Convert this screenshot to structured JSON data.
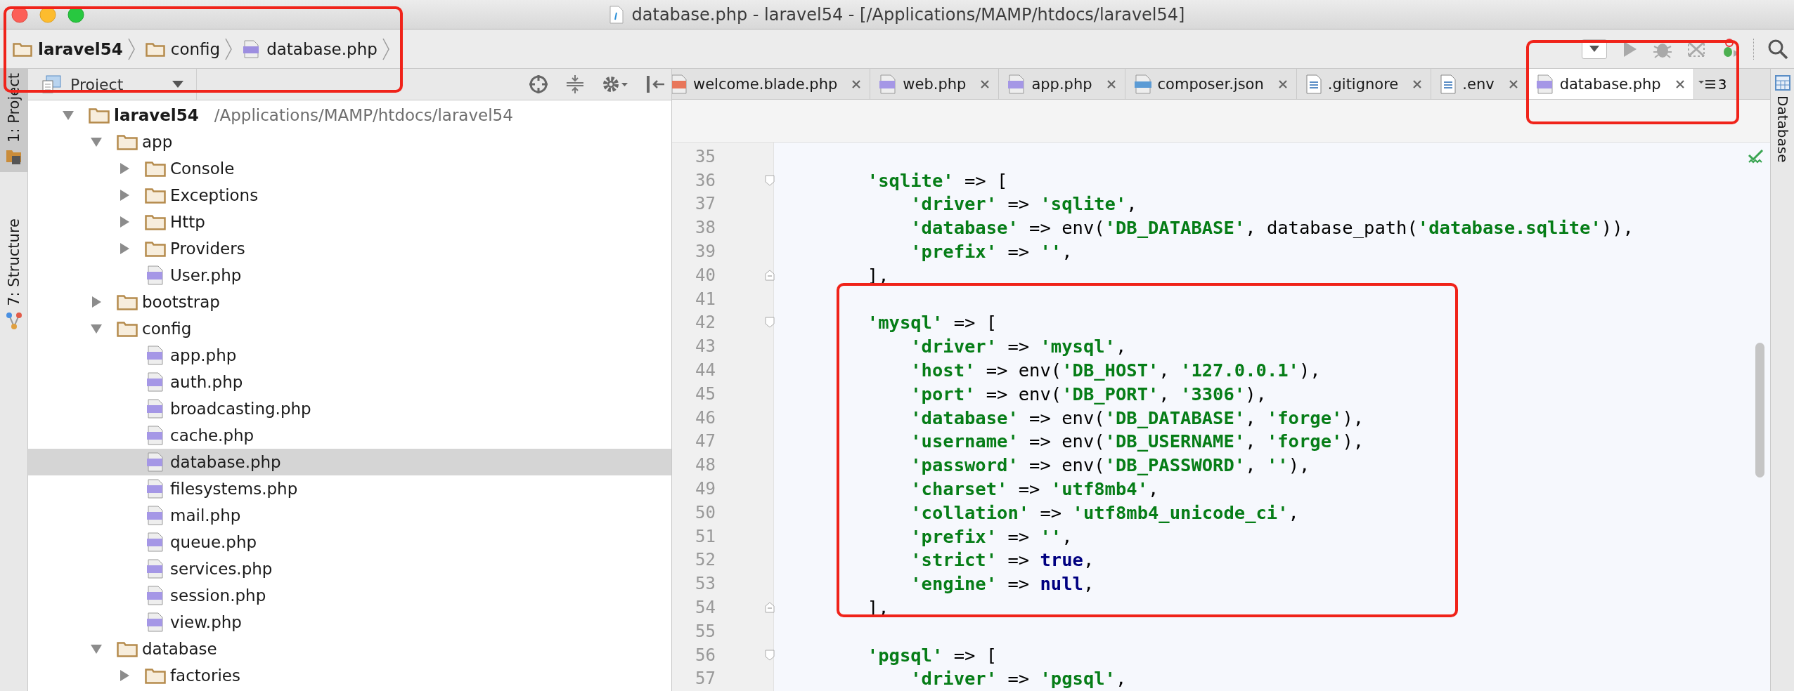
{
  "window": {
    "title": "database.php - laravel54 - [/Applications/MAMP/htdocs/laravel54]"
  },
  "breadcrumbs": [
    {
      "label": "laravel54",
      "kind": "project"
    },
    {
      "label": "config",
      "kind": "folder"
    },
    {
      "label": "database.php",
      "kind": "php"
    }
  ],
  "left_tool_tabs": [
    {
      "label": "1: Project",
      "selected": true
    },
    {
      "label": "7: Structure",
      "selected": false
    }
  ],
  "project_panel": {
    "title": "Project",
    "tree": [
      {
        "label": "laravel54",
        "path": "/Applications/MAMP/htdocs/laravel54",
        "kind": "project",
        "expanded": true,
        "selected": false,
        "children": [
          {
            "label": "app",
            "kind": "folder",
            "expanded": true,
            "selected": false,
            "children": [
              {
                "label": "Console",
                "kind": "folder",
                "expanded": false,
                "selected": false
              },
              {
                "label": "Exceptions",
                "kind": "folder",
                "expanded": false,
                "selected": false
              },
              {
                "label": "Http",
                "kind": "folder",
                "expanded": false,
                "selected": false
              },
              {
                "label": "Providers",
                "kind": "folder",
                "expanded": false,
                "selected": false
              },
              {
                "label": "User.php",
                "kind": "php",
                "selected": false
              }
            ]
          },
          {
            "label": "bootstrap",
            "kind": "folder",
            "expanded": false,
            "selected": false
          },
          {
            "label": "config",
            "kind": "folder",
            "expanded": true,
            "selected": false,
            "children": [
              {
                "label": "app.php",
                "kind": "php",
                "selected": false
              },
              {
                "label": "auth.php",
                "kind": "php",
                "selected": false
              },
              {
                "label": "broadcasting.php",
                "kind": "php",
                "selected": false
              },
              {
                "label": "cache.php",
                "kind": "php",
                "selected": false
              },
              {
                "label": "database.php",
                "kind": "php",
                "selected": true
              },
              {
                "label": "filesystems.php",
                "kind": "php",
                "selected": false
              },
              {
                "label": "mail.php",
                "kind": "php",
                "selected": false
              },
              {
                "label": "queue.php",
                "kind": "php",
                "selected": false
              },
              {
                "label": "services.php",
                "kind": "php",
                "selected": false
              },
              {
                "label": "session.php",
                "kind": "php",
                "selected": false
              },
              {
                "label": "view.php",
                "kind": "php",
                "selected": false
              }
            ]
          },
          {
            "label": "database",
            "kind": "folder",
            "expanded": true,
            "selected": false,
            "children": [
              {
                "label": "factories",
                "kind": "folder",
                "expanded": false,
                "selected": false
              }
            ]
          }
        ]
      }
    ]
  },
  "tabs": [
    {
      "label": "welcome.blade.php",
      "kind": "blade",
      "selected": false
    },
    {
      "label": "web.php",
      "kind": "php",
      "selected": false
    },
    {
      "label": "app.php",
      "kind": "php",
      "selected": false
    },
    {
      "label": "composer.json",
      "kind": "json",
      "selected": false
    },
    {
      "label": ".gitignore",
      "kind": "text",
      "selected": false
    },
    {
      "label": ".env",
      "kind": "text",
      "selected": false
    },
    {
      "label": "database.php",
      "kind": "php",
      "selected": true
    }
  ],
  "tabs_overflow": "3",
  "right_tool_tabs": [
    {
      "label": "Database",
      "selected": false
    }
  ],
  "editor": {
    "lines": [
      {
        "number": "35",
        "kind": "code"
      },
      {
        "number": "36",
        "kind": "fold_start",
        "tokens": [
          {
            "kind": "str",
            "text": "        'sqlite'"
          },
          {
            "kind": "plain",
            "text": " => ["
          }
        ]
      },
      {
        "number": "37",
        "kind": "code",
        "tokens": [
          {
            "kind": "str",
            "text": "            'driver'"
          },
          {
            "kind": "plain",
            "text": " => "
          },
          {
            "kind": "str",
            "text": "'sqlite'"
          },
          {
            "kind": "plain",
            "text": ","
          }
        ]
      },
      {
        "number": "38",
        "kind": "code",
        "tokens": [
          {
            "kind": "str",
            "text": "            'database'"
          },
          {
            "kind": "plain",
            "text": " => env("
          },
          {
            "kind": "str",
            "text": "'DB_DATABASE'"
          },
          {
            "kind": "plain",
            "text": ", database_path("
          },
          {
            "kind": "str",
            "text": "'database.sqlite'"
          },
          {
            "kind": "plain",
            "text": ")),"
          }
        ]
      },
      {
        "number": "39",
        "kind": "code",
        "tokens": [
          {
            "kind": "str",
            "text": "            'prefix'"
          },
          {
            "kind": "plain",
            "text": " => "
          },
          {
            "kind": "str",
            "text": "''"
          },
          {
            "kind": "plain",
            "text": ","
          }
        ]
      },
      {
        "number": "40",
        "kind": "fold_end",
        "tokens": [
          {
            "kind": "plain",
            "text": "        ],"
          }
        ]
      },
      {
        "number": "41",
        "kind": "code"
      },
      {
        "number": "42",
        "kind": "fold_start",
        "tokens": [
          {
            "kind": "str",
            "text": "        'mysql'"
          },
          {
            "kind": "plain",
            "text": " => ["
          }
        ]
      },
      {
        "number": "43",
        "kind": "code",
        "tokens": [
          {
            "kind": "str",
            "text": "            'driver'"
          },
          {
            "kind": "plain",
            "text": " => "
          },
          {
            "kind": "str",
            "text": "'mysql'"
          },
          {
            "kind": "plain",
            "text": ","
          }
        ]
      },
      {
        "number": "44",
        "kind": "code",
        "tokens": [
          {
            "kind": "str",
            "text": "            'host'"
          },
          {
            "kind": "plain",
            "text": " => env("
          },
          {
            "kind": "str",
            "text": "'DB_HOST'"
          },
          {
            "kind": "plain",
            "text": ", "
          },
          {
            "kind": "str",
            "text": "'127.0.0.1'"
          },
          {
            "kind": "plain",
            "text": "),"
          }
        ]
      },
      {
        "number": "45",
        "kind": "code",
        "tokens": [
          {
            "kind": "str",
            "text": "            'port'"
          },
          {
            "kind": "plain",
            "text": " => env("
          },
          {
            "kind": "str",
            "text": "'DB_PORT'"
          },
          {
            "kind": "plain",
            "text": ", "
          },
          {
            "kind": "str",
            "text": "'3306'"
          },
          {
            "kind": "plain",
            "text": "),"
          }
        ]
      },
      {
        "number": "46",
        "kind": "code",
        "tokens": [
          {
            "kind": "str",
            "text": "            'database'"
          },
          {
            "kind": "plain",
            "text": " => env("
          },
          {
            "kind": "str",
            "text": "'DB_DATABASE'"
          },
          {
            "kind": "plain",
            "text": ", "
          },
          {
            "kind": "str",
            "text": "'forge'"
          },
          {
            "kind": "plain",
            "text": "),"
          }
        ]
      },
      {
        "number": "47",
        "kind": "code",
        "tokens": [
          {
            "kind": "str",
            "text": "            'username'"
          },
          {
            "kind": "plain",
            "text": " => env("
          },
          {
            "kind": "str",
            "text": "'DB_USERNAME'"
          },
          {
            "kind": "plain",
            "text": ", "
          },
          {
            "kind": "str",
            "text": "'forge'"
          },
          {
            "kind": "plain",
            "text": "),"
          }
        ]
      },
      {
        "number": "48",
        "kind": "code",
        "tokens": [
          {
            "kind": "str",
            "text": "            'password'"
          },
          {
            "kind": "plain",
            "text": " => env("
          },
          {
            "kind": "str",
            "text": "'DB_PASSWORD'"
          },
          {
            "kind": "plain",
            "text": ", "
          },
          {
            "kind": "str",
            "text": "''"
          },
          {
            "kind": "plain",
            "text": "),"
          }
        ]
      },
      {
        "number": "49",
        "kind": "code",
        "tokens": [
          {
            "kind": "str",
            "text": "            'charset'"
          },
          {
            "kind": "plain",
            "text": " => "
          },
          {
            "kind": "str",
            "text": "'utf8mb4'"
          },
          {
            "kind": "plain",
            "text": ","
          }
        ]
      },
      {
        "number": "50",
        "kind": "code",
        "tokens": [
          {
            "kind": "str",
            "text": "            'collation'"
          },
          {
            "kind": "plain",
            "text": " => "
          },
          {
            "kind": "str",
            "text": "'utf8mb4_unicode_ci'"
          },
          {
            "kind": "plain",
            "text": ","
          }
        ]
      },
      {
        "number": "51",
        "kind": "code",
        "tokens": [
          {
            "kind": "str",
            "text": "            'prefix'"
          },
          {
            "kind": "plain",
            "text": " => "
          },
          {
            "kind": "str",
            "text": "''"
          },
          {
            "kind": "plain",
            "text": ","
          }
        ]
      },
      {
        "number": "52",
        "kind": "code",
        "tokens": [
          {
            "kind": "str",
            "text": "            'strict'"
          },
          {
            "kind": "plain",
            "text": " => "
          },
          {
            "kind": "kw",
            "text": "true"
          },
          {
            "kind": "plain",
            "text": ","
          }
        ]
      },
      {
        "number": "53",
        "kind": "code",
        "tokens": [
          {
            "kind": "str",
            "text": "            'engine'"
          },
          {
            "kind": "plain",
            "text": " => "
          },
          {
            "kind": "kw",
            "text": "null"
          },
          {
            "kind": "plain",
            "text": ","
          }
        ]
      },
      {
        "number": "54",
        "kind": "fold_end",
        "tokens": [
          {
            "kind": "plain",
            "text": "        ],"
          }
        ]
      },
      {
        "number": "55",
        "kind": "code"
      },
      {
        "number": "56",
        "kind": "fold_start",
        "tokens": [
          {
            "kind": "str",
            "text": "        'pgsql'"
          },
          {
            "kind": "plain",
            "text": " => ["
          }
        ]
      },
      {
        "number": "57",
        "kind": "code",
        "tokens": [
          {
            "kind": "str",
            "text": "            'driver'"
          },
          {
            "kind": "plain",
            "text": " => "
          },
          {
            "kind": "str",
            "text": "'pgsql'"
          },
          {
            "kind": "plain",
            "text": ","
          }
        ]
      }
    ]
  }
}
